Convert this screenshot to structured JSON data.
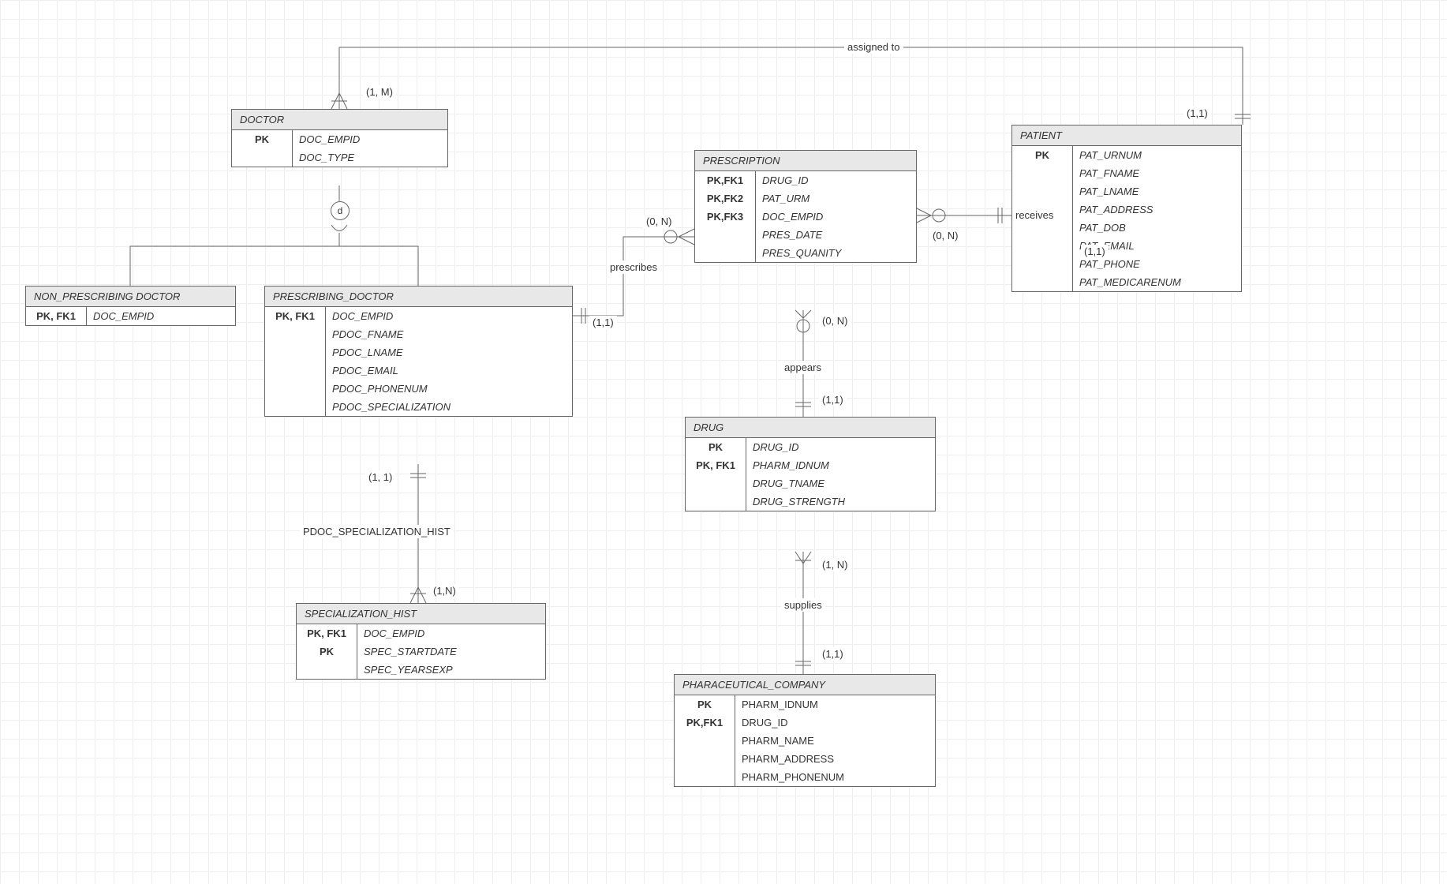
{
  "entities": {
    "doctor": {
      "name": "DOCTOR",
      "rows": [
        [
          "PK",
          "DOC_EMPID"
        ],
        [
          "",
          "DOC_TYPE"
        ]
      ]
    },
    "nonPrescribing": {
      "name": "NON_PRESCRIBING DOCTOR",
      "rows": [
        [
          "PK, FK1",
          "DOC_EMPID"
        ]
      ]
    },
    "prescribing": {
      "name": "PRESCRIBING_DOCTOR",
      "rows": [
        [
          "PK, FK1",
          "DOC_EMPID"
        ],
        [
          "",
          "PDOC_FNAME"
        ],
        [
          "",
          "PDOC_LNAME"
        ],
        [
          "",
          "PDOC_EMAIL"
        ],
        [
          "",
          "PDOC_PHONENUM"
        ],
        [
          "",
          "PDOC_SPECIALIZATION"
        ]
      ]
    },
    "specHist": {
      "name": "SPECIALIZATION_HIST",
      "rows": [
        [
          "PK, FK1",
          "DOC_EMPID"
        ],
        [
          "PK",
          "SPEC_STARTDATE"
        ],
        [
          "",
          "SPEC_YEARSEXP"
        ]
      ]
    },
    "prescription": {
      "name": "PRESCRIPTION",
      "rows": [
        [
          "PK,FK1",
          "DRUG_ID"
        ],
        [
          "PK,FK2",
          "PAT_URM"
        ],
        [
          "PK,FK3",
          "DOC_EMPID"
        ],
        [
          "",
          "PRES_DATE"
        ],
        [
          "",
          "PRES_QUANITY"
        ]
      ]
    },
    "patient": {
      "name": "PATIENT",
      "rows": [
        [
          "PK",
          "PAT_URNUM"
        ],
        [
          "",
          "PAT_FNAME"
        ],
        [
          "",
          "PAT_LNAME"
        ],
        [
          "",
          "PAT_ADDRESS"
        ],
        [
          "",
          "PAT_DOB"
        ],
        [
          "",
          "PAT_EMAIL"
        ],
        [
          "",
          "PAT_PHONE"
        ],
        [
          "",
          "PAT_MEDICARENUM"
        ]
      ]
    },
    "drug": {
      "name": "DRUG",
      "rows": [
        [
          "PK",
          "DRUG_ID"
        ],
        [
          "PK, FK1",
          "PHARM_IDNUM"
        ],
        [
          "",
          "DRUG_TNAME"
        ],
        [
          "",
          "DRUG_STRENGTH"
        ]
      ]
    },
    "pharma": {
      "name": "PHARACEUTICAL_COMPANY",
      "rows": [
        [
          "PK",
          "PHARM_IDNUM"
        ],
        [
          "PK,FK1",
          "DRUG_ID"
        ],
        [
          "",
          "PHARM_NAME"
        ],
        [
          "",
          "PHARM_ADDRESS"
        ],
        [
          "",
          "PHARM_PHONENUM"
        ]
      ]
    }
  },
  "relationships": {
    "assigned": {
      "label": "assigned to",
      "card_left": "(1, M)",
      "card_right": "(1,1)"
    },
    "prescribes": {
      "label": "prescribes",
      "card_left": "(1,1)",
      "card_right": "(0, N)"
    },
    "receives": {
      "label": "receives",
      "card_left": "(0, N)",
      "card_right": "(1,1)"
    },
    "appears": {
      "label": "appears",
      "card_right": "(0, N)",
      "card_bottom": "(1,1)"
    },
    "supplies": {
      "label": "supplies",
      "card_top": "(1, N)",
      "card_bottom": "(1,1)"
    },
    "specHistRel": {
      "label": "PDOC_SPECIALIZATION_HIST",
      "card_left": "(1, 1)",
      "card_right": "(1,N)"
    }
  },
  "disjoint": "d"
}
